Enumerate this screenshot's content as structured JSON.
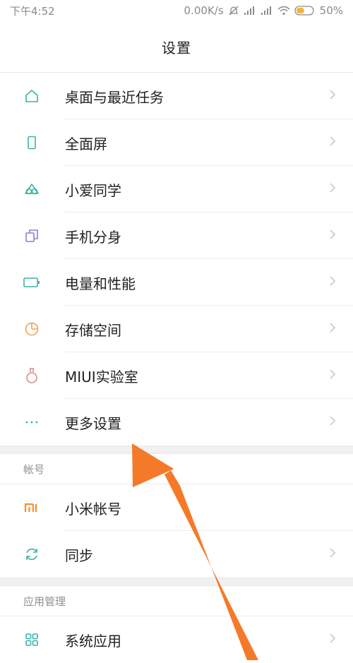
{
  "status_bar": {
    "time": "下午4:52",
    "speed": "0.00K/s",
    "battery": "50%"
  },
  "header": {
    "title": "设置"
  },
  "main_items": [
    {
      "label": "桌面与最近任务",
      "icon": "home-icon"
    },
    {
      "label": "全面屏",
      "icon": "phone-icon"
    },
    {
      "label": "小爱同学",
      "icon": "assistant-icon"
    },
    {
      "label": "手机分身",
      "icon": "dual-app-icon"
    },
    {
      "label": "电量和性能",
      "icon": "battery-icon"
    },
    {
      "label": "存储空间",
      "icon": "storage-pie-icon"
    },
    {
      "label": "MIUI实验室",
      "icon": "flask-icon"
    },
    {
      "label": "更多设置",
      "icon": "more-dots-icon"
    }
  ],
  "account_section": {
    "header": "帐号",
    "items": [
      {
        "label": "小米帐号",
        "icon": "mi-logo-icon"
      },
      {
        "label": "同步",
        "icon": "sync-icon"
      }
    ]
  },
  "apps_section": {
    "header": "应用管理",
    "items": [
      {
        "label": "系统应用",
        "icon": "grid-apps-icon"
      }
    ]
  },
  "colors": {
    "icon_teal": "#3bb3a3",
    "icon_purple": "#8c7fd6",
    "icon_orange": "#f0a25a",
    "icon_pink": "#d98c8c",
    "mi_orange": "#ff8c26",
    "arrow_orange": "#f47a2a"
  }
}
